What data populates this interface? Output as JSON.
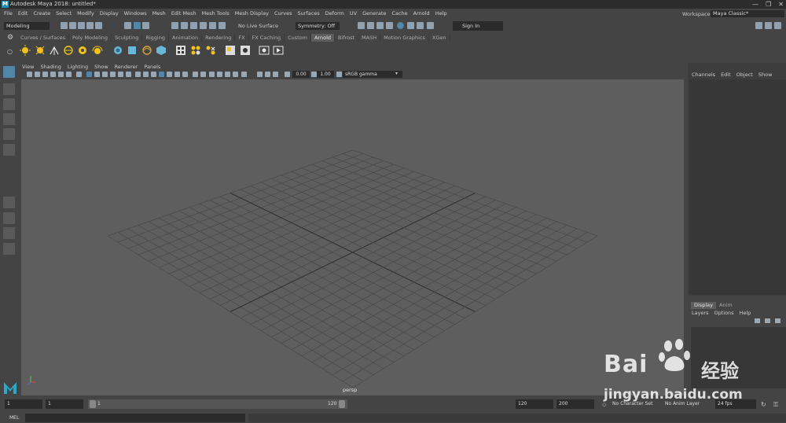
{
  "window": {
    "title": "Autodesk Maya 2018: untitled*",
    "controls": [
      "—",
      "❐",
      "✕"
    ]
  },
  "menubar": {
    "items": [
      "File",
      "Edit",
      "Create",
      "Select",
      "Modify",
      "Display",
      "Windows",
      "Mesh",
      "Edit Mesh",
      "Mesh Tools",
      "Mesh Display",
      "Curves",
      "Surfaces",
      "Deform",
      "UV",
      "Generate",
      "Cache",
      "Arnold",
      "Help"
    ]
  },
  "workspace": {
    "label": "Workspace :",
    "value": "Maya Classic*"
  },
  "statusline": {
    "menu_set": "Modeling",
    "live_surface": "No Live Surface",
    "symmetry": "Symmetry: Off",
    "sign_in": "Sign In"
  },
  "shelf": {
    "tabs": [
      "Curves / Surfaces",
      "Poly Modeling",
      "Sculpting",
      "Rigging",
      "Animation",
      "Rendering",
      "FX",
      "FX Caching",
      "Custom",
      "Arnold",
      "Bifrost",
      "MASH",
      "Motion Graphics",
      "XGen"
    ],
    "active_tab": "Arnold"
  },
  "panel": {
    "menu": [
      "View",
      "Shading",
      "Lighting",
      "Show",
      "Renderer",
      "Panels"
    ],
    "exposure": "0.00",
    "gamma": "1.00",
    "color_space": "sRGB gamma",
    "camera": "persp"
  },
  "channel_box": {
    "menu": [
      "Channels",
      "Edit",
      "Object",
      "Show"
    ]
  },
  "layer_editor": {
    "tabs": [
      "Display",
      "Anim"
    ],
    "active_tab": "Display",
    "menu": [
      "Layers",
      "Options",
      "Help"
    ]
  },
  "timeline": {
    "start": "1",
    "current": "1",
    "range_start": "1",
    "range_end": "120",
    "end": "120",
    "anim_end": "200",
    "character_set": "No Character Set",
    "anim_layer": "No Anim Layer",
    "fps": "24 fps"
  },
  "command_line": {
    "label": "MEL"
  },
  "watermark": {
    "brand": "Bai",
    "cn": "经验",
    "url": "jingyan.baidu.com"
  },
  "colors": {
    "viewport": "#5e5e5e",
    "accent": "#5286a8",
    "panel": "#444444"
  }
}
